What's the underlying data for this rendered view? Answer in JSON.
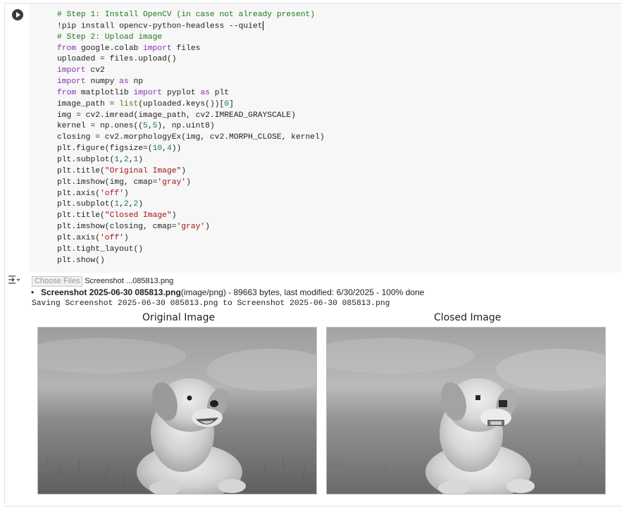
{
  "cell": {
    "run_button": "run-cell",
    "code_lines": [
      [
        [
          "cm",
          "# Step 1: Install OpenCV (in case not already present)"
        ]
      ],
      [
        [
          "pl",
          "!pip install opencv-python-headless --quiet"
        ],
        [
          "caret",
          ""
        ]
      ],
      [
        [
          "cm",
          "# Step 2: Upload image"
        ]
      ],
      [
        [
          "kw",
          "from"
        ],
        [
          "pl",
          " google.colab "
        ],
        [
          "kw",
          "import"
        ],
        [
          "pl",
          " files"
        ]
      ],
      [
        [
          "pl",
          "uploaded = files.upload()"
        ]
      ],
      [
        [
          "kw",
          "import"
        ],
        [
          "pl",
          " cv2"
        ]
      ],
      [
        [
          "kw",
          "import"
        ],
        [
          "pl",
          " numpy "
        ],
        [
          "kw",
          "as"
        ],
        [
          "pl",
          " np"
        ]
      ],
      [
        [
          "kw",
          "from"
        ],
        [
          "pl",
          " matplotlib "
        ],
        [
          "kw",
          "import"
        ],
        [
          "pl",
          " pyplot "
        ],
        [
          "kw",
          "as"
        ],
        [
          "pl",
          " plt"
        ]
      ],
      [
        [
          "pl",
          "image_path = "
        ],
        [
          "fn",
          "list"
        ],
        [
          "pl",
          "(uploaded.keys())["
        ],
        [
          "num",
          "0"
        ],
        [
          "pl",
          "]"
        ]
      ],
      [
        [
          "pl",
          "img = cv2.imread(image_path, cv2.IMREAD_GRAYSCALE)"
        ]
      ],
      [
        [
          "pl",
          "kernel = np.ones(("
        ],
        [
          "num",
          "5"
        ],
        [
          "pl",
          ","
        ],
        [
          "num",
          "5"
        ],
        [
          "pl",
          "), np.uint8)"
        ]
      ],
      [
        [
          "pl",
          "closing = cv2.morphologyEx(img, cv2.MORPH_CLOSE, kernel)"
        ]
      ],
      [
        [
          "pl",
          "plt.figure(figsize=("
        ],
        [
          "num",
          "10"
        ],
        [
          "pl",
          ","
        ],
        [
          "num",
          "4"
        ],
        [
          "pl",
          "))"
        ]
      ],
      [
        [
          "pl",
          "plt.subplot("
        ],
        [
          "num",
          "1"
        ],
        [
          "pl",
          ","
        ],
        [
          "num",
          "2"
        ],
        [
          "pl",
          ","
        ],
        [
          "num",
          "1"
        ],
        [
          "pl",
          ")"
        ]
      ],
      [
        [
          "pl",
          "plt.title("
        ],
        [
          "str",
          "\"Original Image\""
        ],
        [
          "pl",
          ")"
        ]
      ],
      [
        [
          "pl",
          "plt.imshow(img, cmap="
        ],
        [
          "str",
          "'gray'"
        ],
        [
          "pl",
          ")"
        ]
      ],
      [
        [
          "pl",
          "plt.axis("
        ],
        [
          "str",
          "'off'"
        ],
        [
          "pl",
          ")"
        ]
      ],
      [
        [
          "pl",
          "plt.subplot("
        ],
        [
          "num",
          "1"
        ],
        [
          "pl",
          ","
        ],
        [
          "num",
          "2"
        ],
        [
          "pl",
          ","
        ],
        [
          "num",
          "2"
        ],
        [
          "pl",
          ")"
        ]
      ],
      [
        [
          "pl",
          "plt.title("
        ],
        [
          "str",
          "\"Closed Image\""
        ],
        [
          "pl",
          ")"
        ]
      ],
      [
        [
          "pl",
          "plt.imshow(closing, cmap="
        ],
        [
          "str",
          "'gray'"
        ],
        [
          "pl",
          ")"
        ]
      ],
      [
        [
          "pl",
          "plt.axis("
        ],
        [
          "str",
          "'off'"
        ],
        [
          "pl",
          ")"
        ]
      ],
      [
        [
          "pl",
          "plt.tight_layout()"
        ]
      ],
      [
        [
          "pl",
          "plt.show()"
        ]
      ]
    ]
  },
  "output": {
    "choose_files_label": "Choose Files",
    "chosen_file_short": "Screenshot ...085813.png",
    "file_item_name": "Screenshot 2025-06-30 085813.png",
    "file_item_details": "(image/png) - 89663 bytes, last modified: 6/30/2025 - 100% done",
    "saving_text": "Saving Screenshot 2025-06-30 085813.png to Screenshot 2025-06-30 085813.png",
    "plot_titles": [
      "Original Image",
      "Closed Image"
    ]
  }
}
